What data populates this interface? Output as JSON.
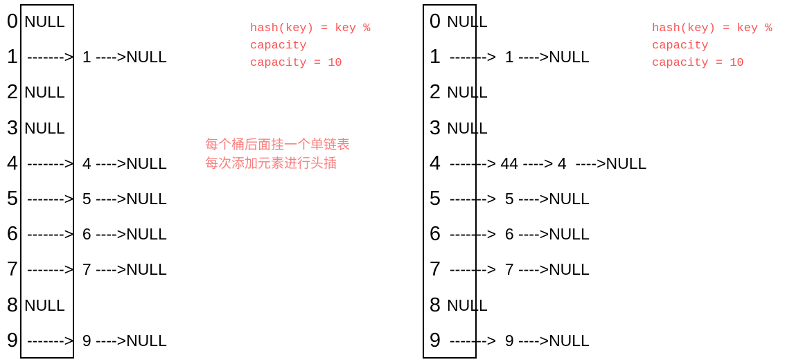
{
  "diagram": {
    "title": "HashMap separate chaining buckets",
    "accent_red": "#fb5353",
    "note_pink": "#fa8080",
    "null_label": "NULL",
    "capacity": 10
  },
  "notes": {
    "hash_formula": "hash(key) = key %\ncapacity\ncapacity = 10",
    "chaining_cn": "每个桶后面挂一个单链表\n每次添加元素进行头插"
  },
  "panels": [
    {
      "id": "before",
      "buckets": [
        {
          "index": "0",
          "empty": true,
          "content": "NULL"
        },
        {
          "index": "1",
          "empty": false,
          "content": "------->  1 ---->NULL"
        },
        {
          "index": "2",
          "empty": true,
          "content": "NULL"
        },
        {
          "index": "3",
          "empty": true,
          "content": "NULL"
        },
        {
          "index": "4",
          "empty": false,
          "content": "------->  4 ---->NULL"
        },
        {
          "index": "5",
          "empty": false,
          "content": "------->  5 ---->NULL"
        },
        {
          "index": "6",
          "empty": false,
          "content": "------->  6 ---->NULL"
        },
        {
          "index": "7",
          "empty": false,
          "content": "------->  7 ---->NULL"
        },
        {
          "index": "8",
          "empty": true,
          "content": "NULL"
        },
        {
          "index": "9",
          "empty": false,
          "content": "------->  9 ---->NULL"
        }
      ]
    },
    {
      "id": "after",
      "buckets": [
        {
          "index": "0",
          "empty": true,
          "content": "NULL"
        },
        {
          "index": "1",
          "empty": false,
          "content": "------->  1 ---->NULL"
        },
        {
          "index": "2",
          "empty": true,
          "content": "NULL"
        },
        {
          "index": "3",
          "empty": true,
          "content": "NULL"
        },
        {
          "index": "4",
          "empty": false,
          "content": "-------> 44 ----> 4  ---->NULL"
        },
        {
          "index": "5",
          "empty": false,
          "content": "------->  5 ---->NULL"
        },
        {
          "index": "6",
          "empty": false,
          "content": "------->  6 ---->NULL"
        },
        {
          "index": "7",
          "empty": false,
          "content": "------->  7 ---->NULL"
        },
        {
          "index": "8",
          "empty": true,
          "content": "NULL"
        },
        {
          "index": "9",
          "empty": false,
          "content": "------->  9 ---->NULL"
        }
      ]
    }
  ]
}
